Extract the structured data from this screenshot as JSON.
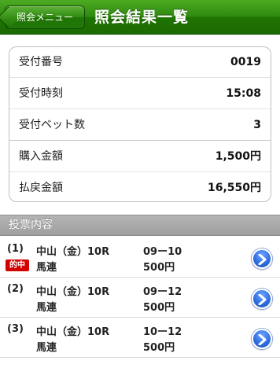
{
  "nav": {
    "back_label": "照会メニュー",
    "title": "照会結果一覧"
  },
  "summary": {
    "rows": [
      {
        "label": "受付番号",
        "value": "0019"
      },
      {
        "label": "受付時刻",
        "value": "15:08"
      },
      {
        "label": "受付ベット数",
        "value": "3"
      },
      {
        "label": "購入金額",
        "value": "1,500円"
      },
      {
        "label": "払戻金額",
        "value": "16,550円"
      }
    ]
  },
  "bets": {
    "header": "投票内容",
    "items": [
      {
        "num": "(1)",
        "race": "中山（金）10R",
        "type": "馬連",
        "combo": "09ー10",
        "amount": "500円",
        "badge": "的中"
      },
      {
        "num": "(2)",
        "race": "中山（金）10R",
        "type": "馬連",
        "combo": "09ー12",
        "amount": "500円"
      },
      {
        "num": "(3)",
        "race": "中山（金）10R",
        "type": "馬連",
        "combo": "10ー12",
        "amount": "500円"
      }
    ]
  },
  "colors": {
    "navbar": "#2f8a0f",
    "hit_badge": "#d40000",
    "detail_button": "#2f6fe0"
  }
}
